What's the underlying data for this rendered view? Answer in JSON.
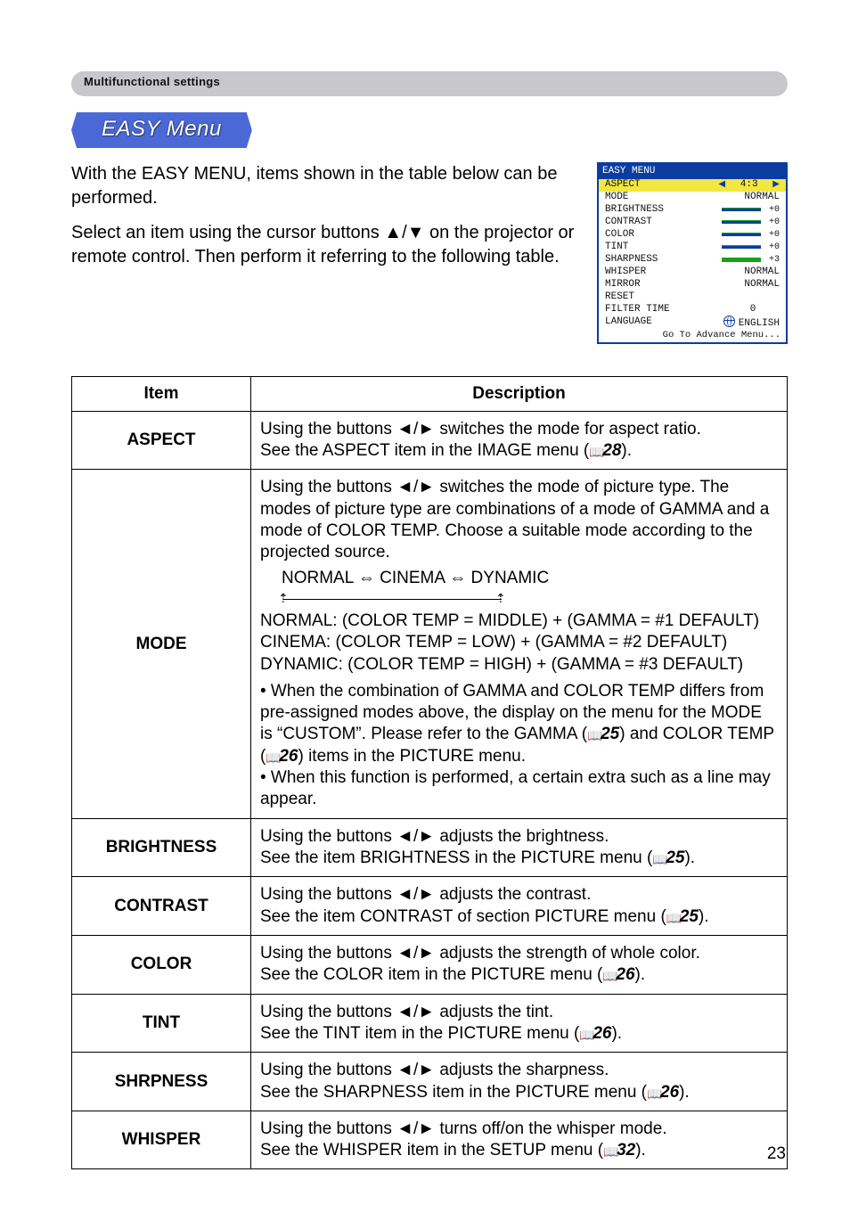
{
  "section_header": "Multifunctional settings",
  "easy_menu_heading": "EASY Menu",
  "intro_para1": "With the EASY MENU, items shown in the table below can be performed.",
  "intro_para2": "Select an item using the cursor buttons ▲/▼ on the projector or remote control. Then perform it referring to the following table.",
  "osd": {
    "title": "EASY MENU",
    "rows": [
      {
        "label": "ASPECT",
        "value": "4:3",
        "active": true,
        "type": "arrows"
      },
      {
        "label": "MODE",
        "value": "NORMAL",
        "type": "plain"
      },
      {
        "label": "BRIGHTNESS",
        "value": "+0",
        "type": "bar-top"
      },
      {
        "label": "CONTRAST",
        "value": "+0",
        "type": "bar-top"
      },
      {
        "label": "COLOR",
        "value": "+0",
        "type": "bar-top"
      },
      {
        "label": "TINT",
        "value": "+0",
        "type": "bar-top"
      },
      {
        "label": "SHARPNESS",
        "value": "+3",
        "type": "bar-full"
      },
      {
        "label": "WHISPER",
        "value": "NORMAL",
        "type": "plain"
      },
      {
        "label": "MIRROR",
        "value": "NORMAL",
        "type": "plain"
      },
      {
        "label": "RESET",
        "value": "",
        "type": "plain"
      },
      {
        "label": "FILTER TIME",
        "value": "0",
        "type": "plain-center"
      },
      {
        "label": "LANGUAGE",
        "value": "ENGLISH",
        "type": "globe"
      }
    ],
    "footer": "Go To Advance Menu..."
  },
  "table_header_item": "Item",
  "table_header_desc": "Description",
  "rows": {
    "aspect": {
      "item": "ASPECT",
      "line1": "Using the buttons ◄/► switches the mode for aspect ratio.",
      "line2_pre": "See the ASPECT item in the IMAGE menu (",
      "line2_ref": "28",
      "line2_post": ")."
    },
    "mode": {
      "item": "MODE",
      "p1": "Using the buttons ◄/► switches the mode of picture type. The modes of picture type are combinations of a mode of GAMMA and a mode of COLOR TEMP. Choose a suitable mode according to the projected source.",
      "cycle": "NORMAL ⇔ CINEMA ⇔ DYNAMIC",
      "normal": "NORMAL: (COLOR TEMP = MIDDLE) + (GAMMA = #1 DEFAULT)",
      "cinema": "CINEMA: (COLOR TEMP = LOW) + (GAMMA = #2 DEFAULT)",
      "dynamic": "DYNAMIC: (COLOR TEMP = HIGH) + (GAMMA = #3 DEFAULT)",
      "bullet1_pre": "• When the combination of GAMMA and COLOR TEMP differs from pre-assigned modes above, the display on the menu for the MODE is “CUSTOM”. Please refer to the GAMMA (",
      "bullet1_ref1": "25",
      "bullet1_mid": ") and COLOR TEMP (",
      "bullet1_ref2": "26",
      "bullet1_post": ") items in the PICTURE menu.",
      "bullet2": "• When this function is performed, a certain extra such as a line may appear."
    },
    "brightness": {
      "item": "BRIGHTNESS",
      "l1": "Using the buttons ◄/► adjusts the brightness.",
      "l2_pre": "See the item BRIGHTNESS in the PICTURE menu (",
      "l2_ref": "25",
      "l2_post": ")."
    },
    "contrast": {
      "item": "CONTRAST",
      "l1": "Using the buttons ◄/► adjusts the contrast.",
      "l2_pre": "See the item CONTRAST of section PICTURE menu (",
      "l2_ref": "25",
      "l2_post": ")."
    },
    "color": {
      "item": "COLOR",
      "l1": "Using the buttons ◄/► adjusts the strength of whole color.",
      "l2_pre": "See the COLOR item in the PICTURE menu (",
      "l2_ref": "26",
      "l2_post": ")."
    },
    "tint": {
      "item": "TINT",
      "l1": "Using the buttons ◄/► adjusts the tint.",
      "l2_pre": "See the TINT item in the PICTURE menu (",
      "l2_ref": "26",
      "l2_post": ")."
    },
    "shrpness": {
      "item": "SHRPNESS",
      "l1": "Using the buttons ◄/► adjusts the sharpness.",
      "l2_pre": "See the SHARPNESS item in the PICTURE menu (",
      "l2_ref": "26",
      "l2_post": ")."
    },
    "whisper": {
      "item": "WHISPER",
      "l1": "Using the buttons ◄/► turns off/on the whisper mode.",
      "l2_pre": "See the WHISPER item in the SETUP menu (",
      "l2_ref": "32",
      "l2_post": ")."
    }
  },
  "page_number": "23"
}
